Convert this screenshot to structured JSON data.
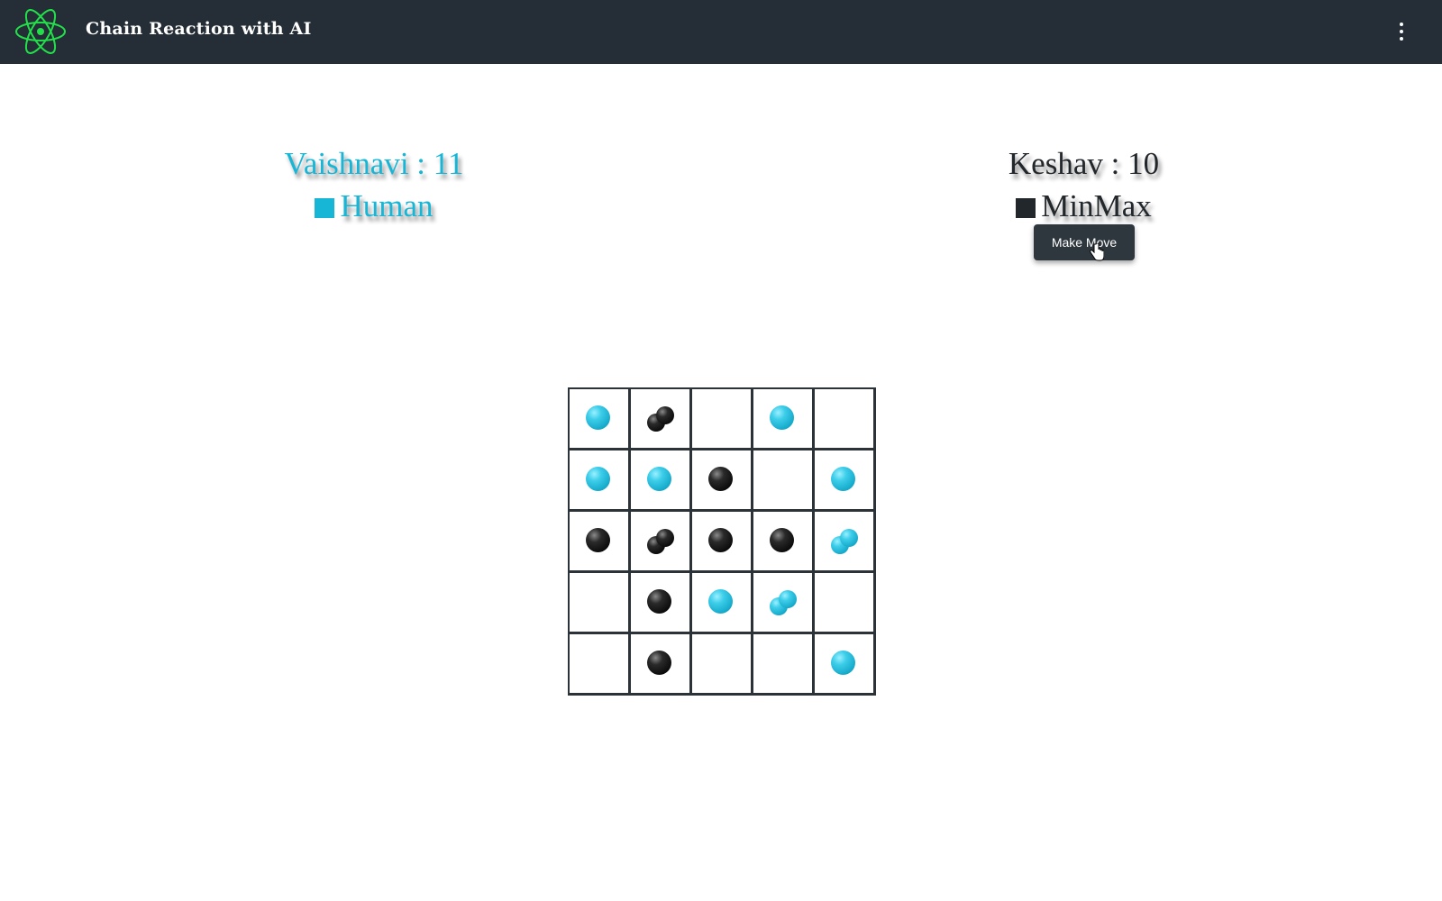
{
  "app": {
    "title": "Chain Reaction with AI",
    "logo_icon": "atom-icon",
    "menu_icon": "more-vertical-icon"
  },
  "players": [
    {
      "name": "Vaishnavi",
      "score": 11,
      "score_text": "Vaishnavi : 11",
      "type": "Human",
      "color": "#17b6d6"
    },
    {
      "name": "Keshav",
      "score": 10,
      "score_text": "Keshav : 10",
      "type": "MinMax",
      "color": "#22272b"
    }
  ],
  "controls": {
    "make_move_label": "Make Move"
  },
  "colors": {
    "header": "#252e36",
    "accent": "#22e04a",
    "player1": "#17b6d6",
    "player2": "#000000"
  },
  "board": {
    "rows": 5,
    "cols": 5,
    "cells": [
      [
        {
          "player": 1,
          "count": 1
        },
        {
          "player": 2,
          "count": 2
        },
        {
          "player": 0,
          "count": 0
        },
        {
          "player": 1,
          "count": 1
        },
        {
          "player": 0,
          "count": 0
        }
      ],
      [
        {
          "player": 1,
          "count": 1
        },
        {
          "player": 1,
          "count": 1
        },
        {
          "player": 2,
          "count": 1
        },
        {
          "player": 0,
          "count": 0
        },
        {
          "player": 1,
          "count": 1
        }
      ],
      [
        {
          "player": 2,
          "count": 1
        },
        {
          "player": 2,
          "count": 2
        },
        {
          "player": 2,
          "count": 1
        },
        {
          "player": 2,
          "count": 1
        },
        {
          "player": 1,
          "count": 2
        }
      ],
      [
        {
          "player": 0,
          "count": 0
        },
        {
          "player": 2,
          "count": 1
        },
        {
          "player": 1,
          "count": 1
        },
        {
          "player": 1,
          "count": 2
        },
        {
          "player": 0,
          "count": 0
        }
      ],
      [
        {
          "player": 0,
          "count": 0
        },
        {
          "player": 2,
          "count": 1
        },
        {
          "player": 0,
          "count": 0
        },
        {
          "player": 0,
          "count": 0
        },
        {
          "player": 1,
          "count": 1
        }
      ]
    ]
  }
}
